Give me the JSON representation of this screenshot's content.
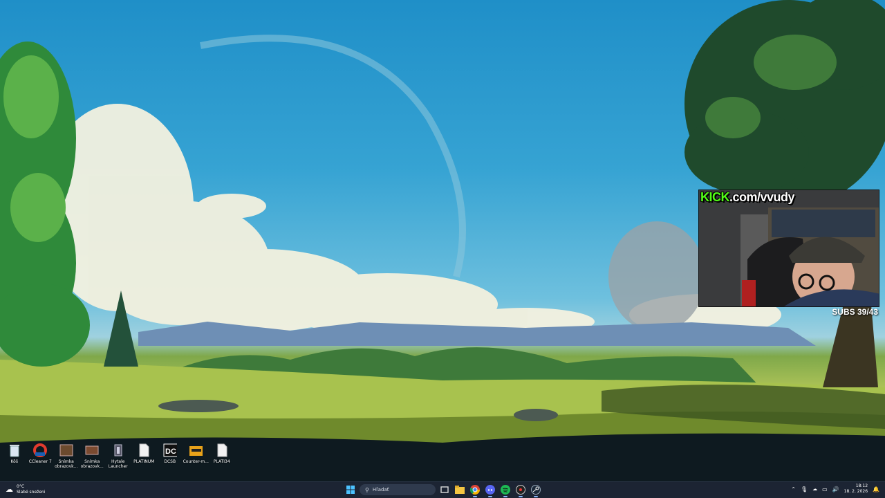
{
  "overlay": {
    "kick_prefix": "KICK",
    "kick_suffix": ".com/vvudy",
    "subs": "SUBS 39/43"
  },
  "desktop_icons": [
    {
      "label": "Kôš",
      "icon": "recycle-bin-icon"
    },
    {
      "label": "CCleaner 7",
      "icon": "ccleaner-icon"
    },
    {
      "label": "Snímka obrazovk...",
      "icon": "screenshot-icon"
    },
    {
      "label": "Snímka obrazovk...",
      "icon": "screenshot-icon"
    },
    {
      "label": "Hytale Launcher",
      "icon": "hytale-icon"
    },
    {
      "label": "PLATINUM",
      "icon": "file-icon"
    },
    {
      "label": "DCSB",
      "icon": "dc-icon"
    },
    {
      "label": "Counter-m...",
      "icon": "folder-icon"
    },
    {
      "label": "PLATI34",
      "icon": "file-icon"
    }
  ],
  "taskbar": {
    "weather_temp": "0°C",
    "weather_text": "Slabé sneženi",
    "search_placeholder": "Hľadať",
    "time": "18:12",
    "date": "18. 2. 2026"
  },
  "colors": {
    "kick_green": "#53fc18",
    "taskbar_bg": "#1c2433"
  }
}
